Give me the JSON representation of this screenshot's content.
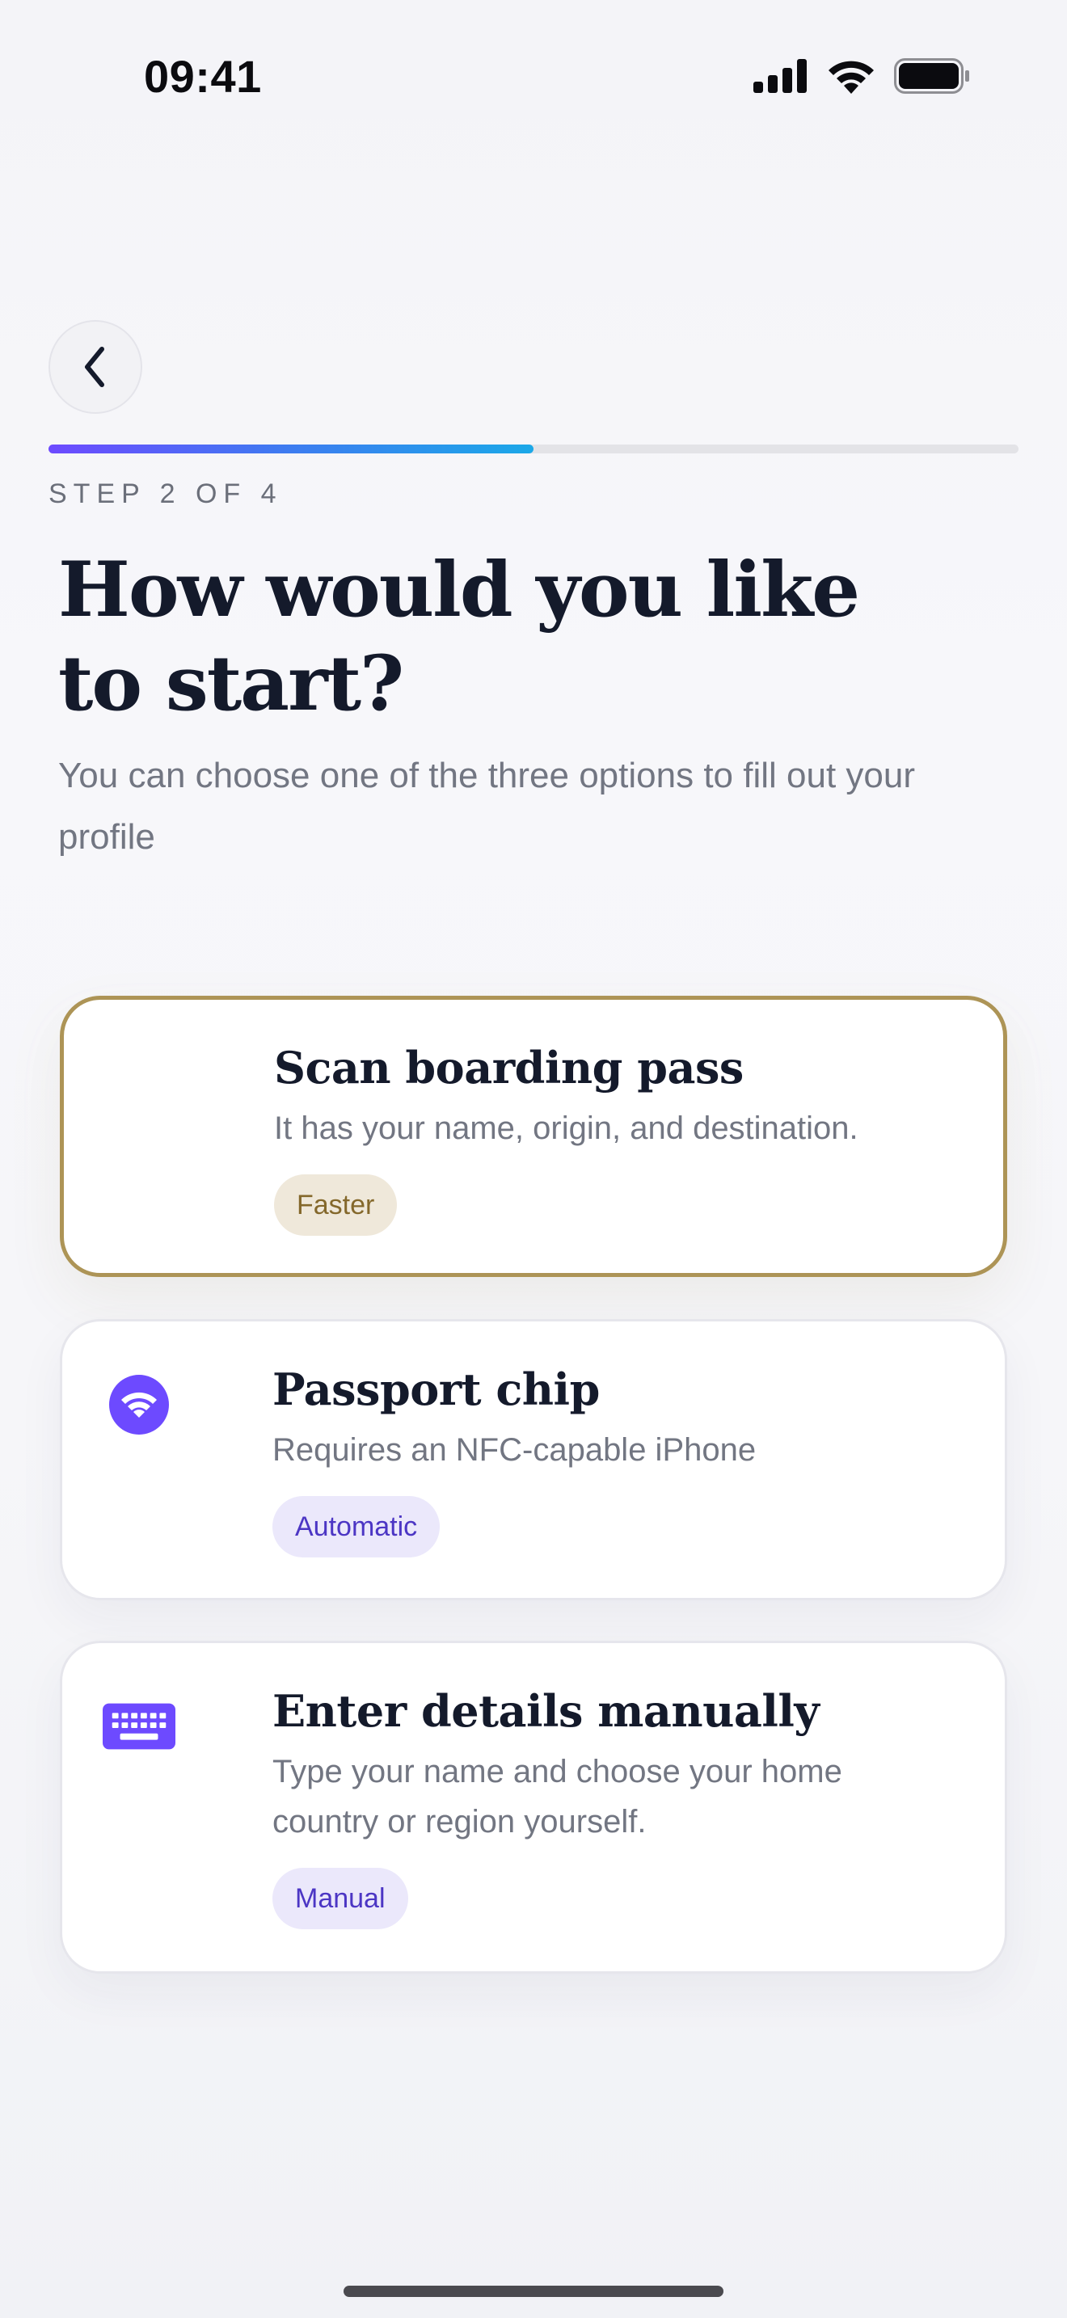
{
  "status_bar": {
    "time": "09:41",
    "icons": [
      "cellular-signal-icon",
      "wifi-icon",
      "battery-icon"
    ]
  },
  "navigation": {
    "back_icon": "chevron-left-icon"
  },
  "progress": {
    "fraction": 0.5,
    "step_label": "STEP 2 OF 4"
  },
  "header": {
    "title_line1": "How would you like",
    "title_line2": "to start?",
    "subtitle": "You can choose one of the three options to fill out your profile"
  },
  "options": [
    {
      "title": "Scan boarding pass",
      "description": "It has your name, origin, and destination.",
      "badge": "Faster",
      "selected": true
    },
    {
      "title": "Passport chip",
      "description": "Requires an NFC-capable iPhone",
      "badge": "Automatic",
      "icon": "wireless-chip-icon",
      "selected": false
    },
    {
      "title": "Enter details manually",
      "description": "Type your name and choose your home country or region yourself.",
      "badge": "Manual",
      "icon": "keyboard-icon",
      "selected": false
    }
  ],
  "colors": {
    "accent_violet": "#6d4aff",
    "accent_blue": "#1ba8e8",
    "selected_border": "#ad9456",
    "badge_gold_text": "#84682b",
    "badge_violet_text": "#4c36c4"
  }
}
